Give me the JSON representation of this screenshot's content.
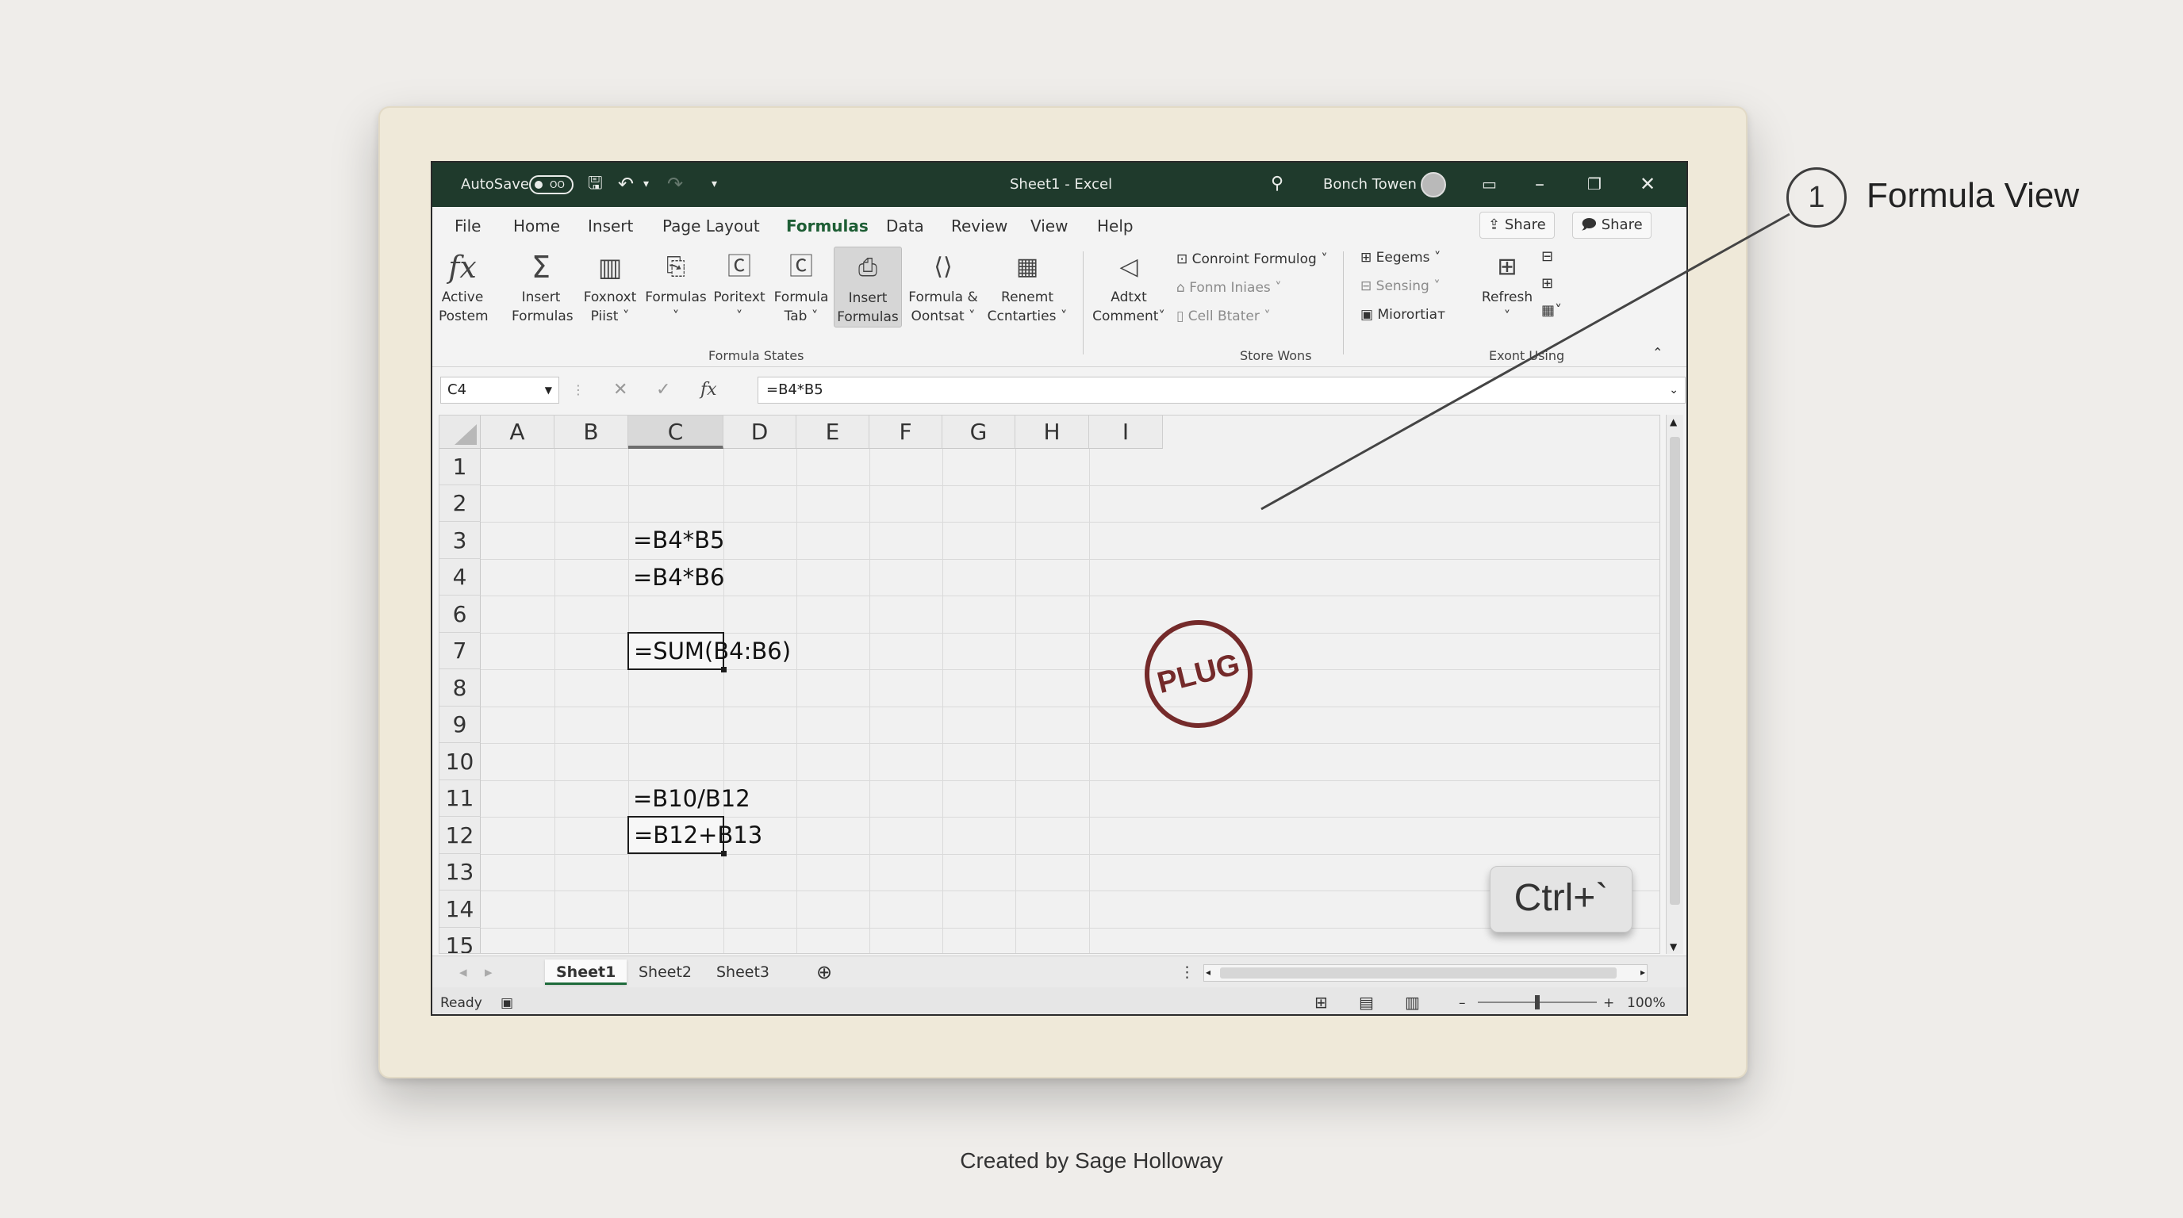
{
  "callout": {
    "number": "1",
    "label": "Formula View"
  },
  "credit": "Created by Sage Holloway",
  "titlebar": {
    "autosave": "AutoSave",
    "autosave_state": "OO",
    "title": "Sheet1  -  Excel",
    "user": "Bonch Towen"
  },
  "menu": {
    "items": [
      "File",
      "Home",
      "Insert",
      "Page Layout",
      "Formulas",
      "Data",
      "Review",
      "View",
      "Help"
    ],
    "active": "Formulas",
    "share1": "Share",
    "share2": "Share"
  },
  "ribbon": {
    "buttons": [
      {
        "l1": "Active",
        "l2": "Postem"
      },
      {
        "l1": "Insert",
        "l2": "Formulas"
      },
      {
        "l1": "Foxnoxt",
        "l2": "Piist ˅"
      },
      {
        "l1": "Formulas",
        "l2": "˅"
      },
      {
        "l1": "Poritext",
        "l2": "˅"
      },
      {
        "l1": "Formula",
        "l2": "Tab ˅"
      },
      {
        "l1": "Insert",
        "l2": "Formulas"
      },
      {
        "l1": "Formula &",
        "l2": "Oontsat ˅"
      },
      {
        "l1": "Renemt",
        "l2": "Ccntarties ˅"
      },
      {
        "l1": "Adtxt",
        "l2": "Comment˅"
      },
      {
        "l1": "Refresh",
        "l2": "˅"
      }
    ],
    "small": {
      "s1": "Conroint Formulog ˅",
      "s2": "Fonm Iniaes ˅",
      "s3": "Cell Btater ˅",
      "s4": "Eegems ˅",
      "s5": "Sensing ˅",
      "s6": "Miorortiaт"
    },
    "groups": {
      "g1": "Formula States",
      "g2": "Store Wons",
      "g3": "Exont Using"
    }
  },
  "formula_bar": {
    "name_box": "C4",
    "content": "=B4*B5"
  },
  "grid": {
    "columns": [
      "A",
      "B",
      "C",
      "D",
      "E",
      "F",
      "G",
      "H",
      "I"
    ],
    "selected_column": "C",
    "rows": [
      "1",
      "2",
      "3",
      "4",
      "6",
      "7",
      "8",
      "9",
      "10",
      "11",
      "12",
      "13",
      "14",
      "15"
    ],
    "cells": {
      "r3": "=B4*B5",
      "r4": "=B4*B6",
      "r7": "=SUM(B4:B6)",
      "r10": "=B10/B12",
      "r12": "=B12+B13"
    }
  },
  "stamp": "PLUG",
  "shortcut": "Ctrl+`",
  "sheets": {
    "tabs": [
      "Sheet1",
      "Sheet2",
      "Sheet3"
    ],
    "active": "Sheet1"
  },
  "status": {
    "ready": "Ready",
    "zoom": "100%"
  },
  "colors": {
    "title_bar": "#1f3a2c",
    "accent": "#1e6b3b",
    "stamp": "#6a1a1a"
  }
}
